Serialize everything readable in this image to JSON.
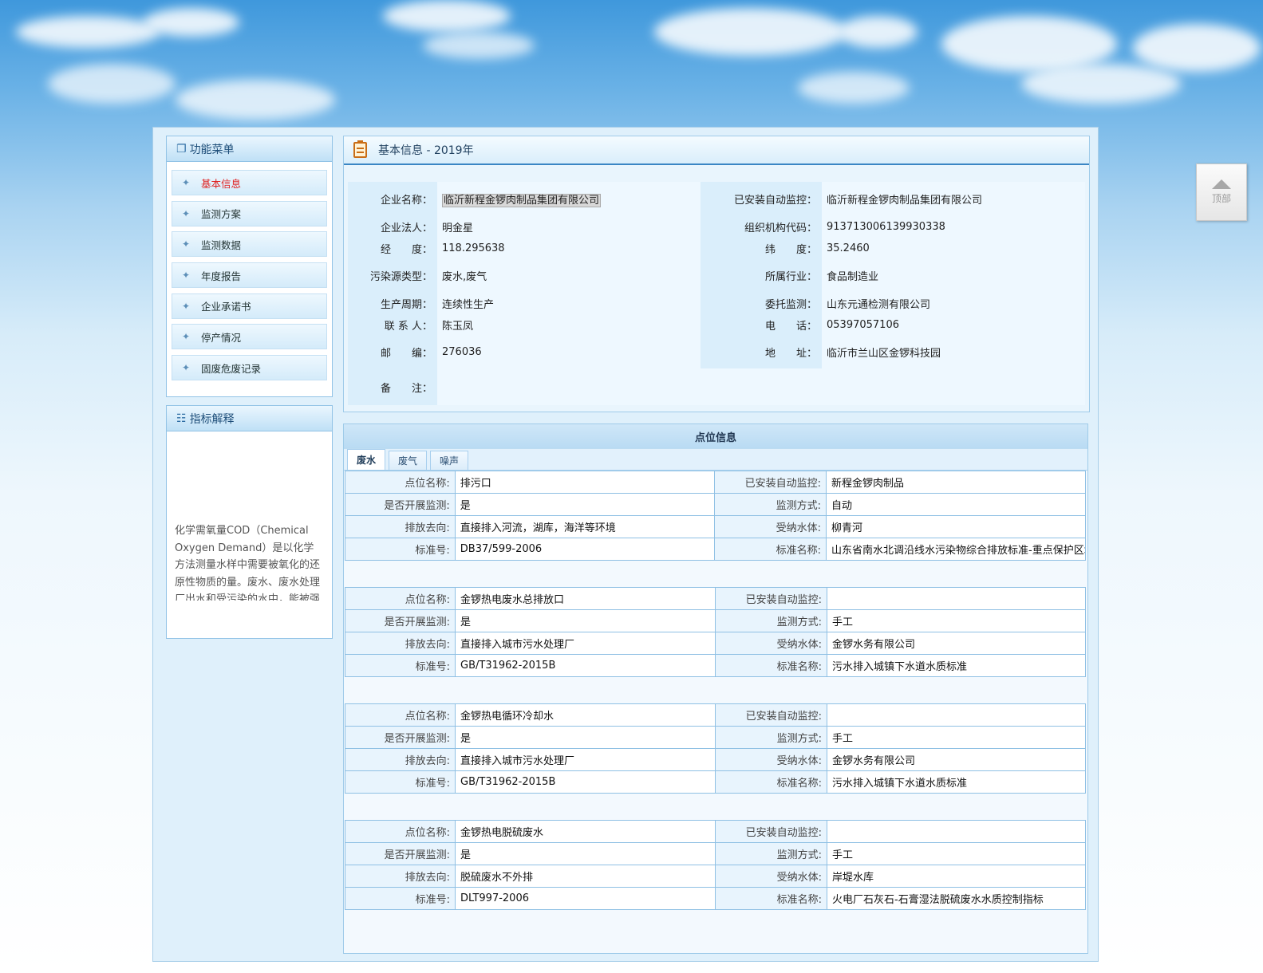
{
  "sidebar": {
    "menu_title": "功能菜单",
    "items": [
      "基本信息",
      "监测方案",
      "监测数据",
      "年度报告",
      "企业承诺书",
      "停产情况",
      "固废危废记录"
    ],
    "explain_title": "指标解释",
    "explain_text": "化学需氧量COD（Chemical Oxygen Demand）是以化学方法测量水样中需要被氧化的还原性物质的量。废水、废水处理厂出水和受污染的水中，能被强氧化剂氧化的物质（一般为有机物）的氧当量。在河流污染和工业废水性质的研究以及废水处理厂的运行管理中，它是一个重要的而且能较快测定的有机物污染参数。"
  },
  "basic": {
    "title": "基本信息 - 2019年",
    "rows": [
      {
        "l1": "企业名称：",
        "v1": "临沂新程金锣肉制品集团有限公司",
        "l2": "已安装自动监控：",
        "v2": "临沂新程金锣肉制品集团有限公司"
      },
      {
        "l1": "企业法人：",
        "v1": "明金星",
        "l2": "组织机构代码：",
        "v2": "913713006139930338"
      },
      {
        "l1": "经　　度：",
        "v1": "118.295638",
        "l2": "纬　　度：",
        "v2": "35.2460"
      },
      {
        "l1": "污染源类型：",
        "v1": "废水,废气",
        "l2": "所属行业：",
        "v2": "食品制造业"
      },
      {
        "l1": "生产周期：",
        "v1": "连续性生产",
        "l2": "委托监测：",
        "v2": "山东元通检测有限公司"
      },
      {
        "l1": "联 系 人：",
        "v1": "陈玉凤",
        "l2": "电　　话：",
        "v2": "05397057106"
      },
      {
        "l1": "邮　　编：",
        "v1": "276036",
        "l2": "地　　址：",
        "v2": "临沂市兰山区金锣科技园"
      },
      {
        "l1": "备　　注：",
        "v1": ""
      }
    ]
  },
  "points": {
    "title": "点位信息",
    "tabs": [
      "废水",
      "废气",
      "噪声"
    ],
    "labels": {
      "name": "点位名称:",
      "auto": "已安装自动监控:",
      "monitor": "是否开展监测:",
      "method": "监测方式:",
      "dest": "排放去向:",
      "water": "受纳水体:",
      "std_no": "标准号:",
      "std_name": "标准名称:"
    },
    "items": [
      {
        "name": "排污口",
        "auto": "新程金锣肉制品",
        "monitor": "是",
        "method": "自动",
        "dest": "直接排入河流，湖库，海洋等环境",
        "water": "柳青河",
        "std_no": "DB37/599-2006",
        "std_name": "山东省南水北调沿线水污染物综合排放标准-重点保护区域"
      },
      {
        "name": "金锣热电废水总排放口",
        "auto": "",
        "monitor": "是",
        "method": "手工",
        "dest": "直接排入城市污水处理厂",
        "water": "金锣水务有限公司",
        "std_no": "GB/T31962-2015B",
        "std_name": "污水排入城镇下水道水质标准"
      },
      {
        "name": "金锣热电循环冷却水",
        "auto": "",
        "monitor": "是",
        "method": "手工",
        "dest": "直接排入城市污水处理厂",
        "water": "金锣水务有限公司",
        "std_no": "GB/T31962-2015B",
        "std_name": "污水排入城镇下水道水质标准"
      },
      {
        "name": "金锣热电脱硫废水",
        "auto": "",
        "monitor": "是",
        "method": "手工",
        "dest": "脱硫废水不外排",
        "water": "岸堤水库",
        "std_no": "DLT997-2006",
        "std_name": "火电厂石灰石-石膏湿法脱硫废水水质控制指标"
      }
    ]
  },
  "top_button": "顶部"
}
